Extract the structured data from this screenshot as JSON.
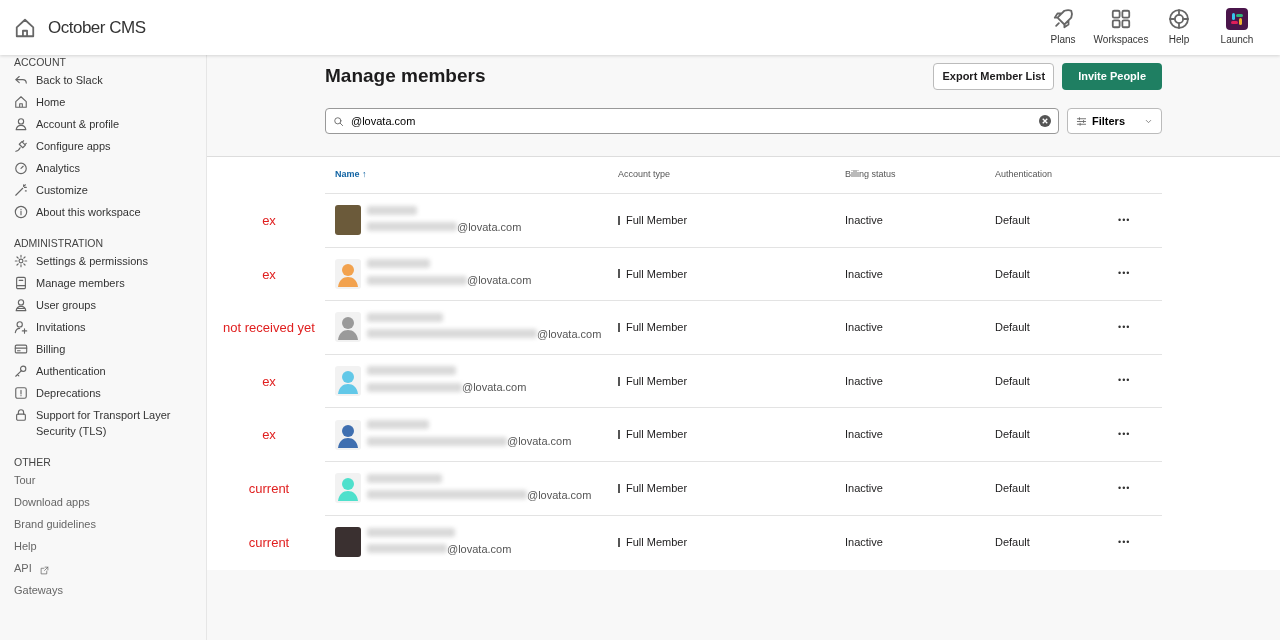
{
  "header": {
    "title": "October CMS",
    "actions": [
      {
        "kind": "rocket",
        "label": "Plans"
      },
      {
        "kind": "grid",
        "label": "Workspaces"
      },
      {
        "kind": "lifebuoy",
        "label": "Help"
      },
      {
        "kind": "app",
        "label": "Launch"
      }
    ]
  },
  "sidebar": {
    "sections": [
      {
        "heading": "ACCOUNT",
        "items": [
          {
            "label": "Back to Slack"
          },
          {
            "label": "Home"
          },
          {
            "label": "Account & profile"
          },
          {
            "label": "Configure apps"
          },
          {
            "label": "Analytics"
          },
          {
            "label": "Customize"
          },
          {
            "label": "About this workspace"
          }
        ]
      },
      {
        "heading": "ADMINISTRATION",
        "items": [
          {
            "label": "Settings & permissions"
          },
          {
            "label": "Manage members"
          },
          {
            "label": "User groups"
          },
          {
            "label": "Invitations"
          },
          {
            "label": "Billing"
          },
          {
            "label": "Authentication"
          },
          {
            "label": "Deprecations"
          },
          {
            "label": "Support for Transport Layer Security (TLS)"
          }
        ]
      },
      {
        "heading": "OTHER",
        "items": [
          {
            "label": "Tour"
          },
          {
            "label": "Download apps"
          },
          {
            "label": "Brand guidelines"
          },
          {
            "label": "Help"
          },
          {
            "label": "API"
          },
          {
            "label": "Gateways"
          }
        ]
      }
    ]
  },
  "page": {
    "title": "Manage members",
    "buttons": [
      {
        "kind": "secondary",
        "label": "Export Member List"
      },
      {
        "kind": "primary",
        "label": "Invite People"
      }
    ],
    "search": {
      "value": "@lovata.com"
    },
    "filters": {
      "label": "Filters"
    }
  },
  "table": {
    "columns": [
      {
        "label": "Name",
        "sorted": true,
        "sort_arrow": "↑"
      },
      {
        "label": "Account type",
        "sorted": false
      },
      {
        "label": "Billing status",
        "sorted": false
      },
      {
        "label": "Authentication",
        "sorted": false
      }
    ],
    "rows": [
      {
        "note": "ex",
        "avatar": {
          "kind": "photo",
          "color": "#6b5a3a"
        },
        "email": "@lovata.com",
        "account_type": "Full Member",
        "billing": "Inactive",
        "auth": "Default",
        "menu": "•••"
      },
      {
        "note": "ex",
        "avatar": {
          "kind": "silhouette",
          "color": "#f2a24e"
        },
        "email": "@lovata.com",
        "account_type": "Full Member",
        "billing": "Inactive",
        "auth": "Default",
        "menu": "•••"
      },
      {
        "note": "not received yet",
        "avatar": {
          "kind": "silhouette",
          "color": "#9a9a9a"
        },
        "email": "@lovata.com",
        "account_type": "Full Member",
        "billing": "Inactive",
        "auth": "Default",
        "menu": "•••"
      },
      {
        "note": "ex",
        "avatar": {
          "kind": "silhouette",
          "color": "#62c8e8"
        },
        "email": "@lovata.com",
        "account_type": "Full Member",
        "billing": "Inactive",
        "auth": "Default",
        "menu": "•••"
      },
      {
        "note": "ex",
        "avatar": {
          "kind": "silhouette",
          "color": "#3f6fb0"
        },
        "email": "@lovata.com",
        "account_type": "Full Member",
        "billing": "Inactive",
        "auth": "Default",
        "menu": "•••"
      },
      {
        "note": "current",
        "avatar": {
          "kind": "silhouette",
          "color": "#4fe0cc"
        },
        "email": "@lovata.com",
        "account_type": "Full Member",
        "billing": "Inactive",
        "auth": "Default",
        "menu": "•••"
      },
      {
        "note": "current",
        "avatar": {
          "kind": "photo",
          "color": "#3a3030"
        },
        "email": "@lovata.com",
        "account_type": "Full Member",
        "billing": "Inactive",
        "auth": "Default",
        "menu": "•••"
      }
    ]
  }
}
